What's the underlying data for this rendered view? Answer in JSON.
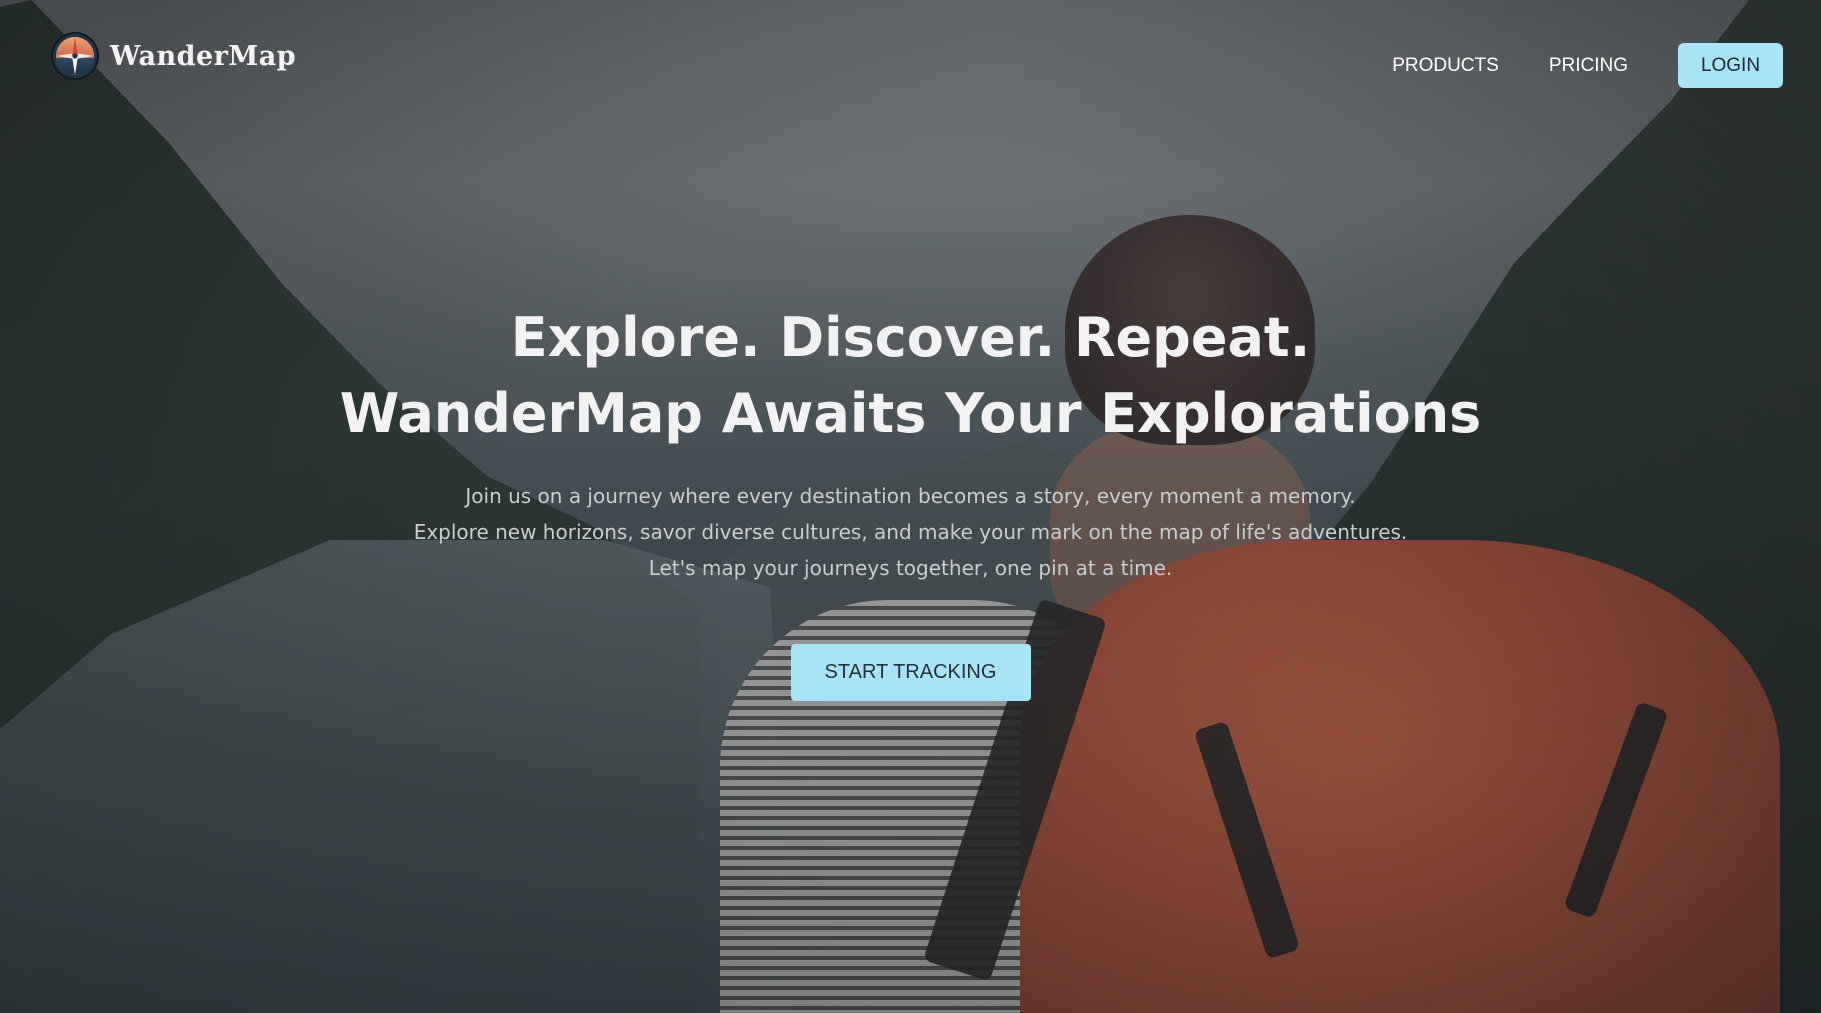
{
  "brand": {
    "name": "WanderMap",
    "logo_icon": "compass-icon"
  },
  "nav": {
    "items": [
      {
        "label": "PRODUCTS"
      },
      {
        "label": "PRICING"
      }
    ],
    "login_label": "LOGIN"
  },
  "hero": {
    "headline_line1": "Explore. Discover. Repeat.",
    "headline_line2": "WanderMap Awaits Your Explorations",
    "subtext_lines": [
      "Join us on a journey where every destination becomes a story, every moment a memory.",
      "Explore new horizons, savor diverse cultures, and make your mark on the map of life's adventures.",
      "Let's map your journeys together, one pin at a time."
    ],
    "cta_label": "START TRACKING"
  },
  "colors": {
    "accent": "#a9e3f6",
    "headline_text": "#f2f2f2",
    "subtext": "#c9cdcf"
  }
}
